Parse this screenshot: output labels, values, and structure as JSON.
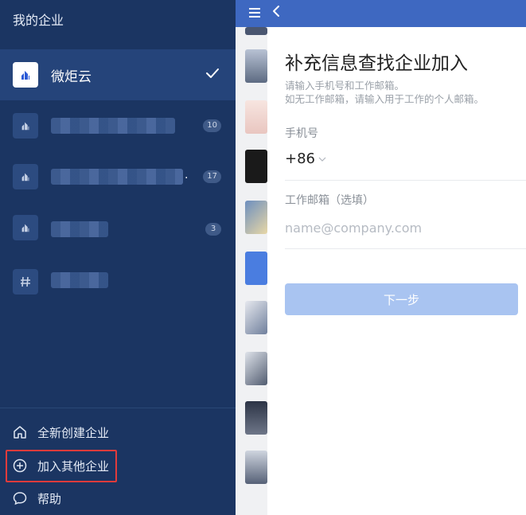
{
  "drawer": {
    "title": "我的企业",
    "orgs": [
      {
        "name": "微炬云",
        "active": true
      },
      {
        "name": "",
        "badge": "10"
      },
      {
        "name": "",
        "badge": "17",
        "trailing": "."
      },
      {
        "name": "",
        "badge": "3"
      },
      {
        "name": "",
        "icon": "hash-icon"
      }
    ],
    "menu": [
      {
        "label": "全新创建企业",
        "icon": "home-icon"
      },
      {
        "label": "加入其他企业",
        "icon": "plus-circle-icon"
      },
      {
        "label": "帮助",
        "icon": "chat-bubble-icon"
      }
    ]
  },
  "right": {
    "title": "补充信息查找企业加入",
    "hint_line1": "请输入手机号和工作邮箱。",
    "hint_line2": "如无工作邮箱，请输入用于工作的个人邮箱。",
    "phone_label": "手机号",
    "phone_prefix": "+86",
    "email_label": "工作邮箱（选填）",
    "email_placeholder": "name@company.com",
    "next_button": "下一步"
  },
  "colors": {
    "drawer_bg": "#1b3562",
    "topbar": "#3e68c1",
    "button_disabled": "#a9c4f1",
    "highlight": "#e23b3b"
  }
}
